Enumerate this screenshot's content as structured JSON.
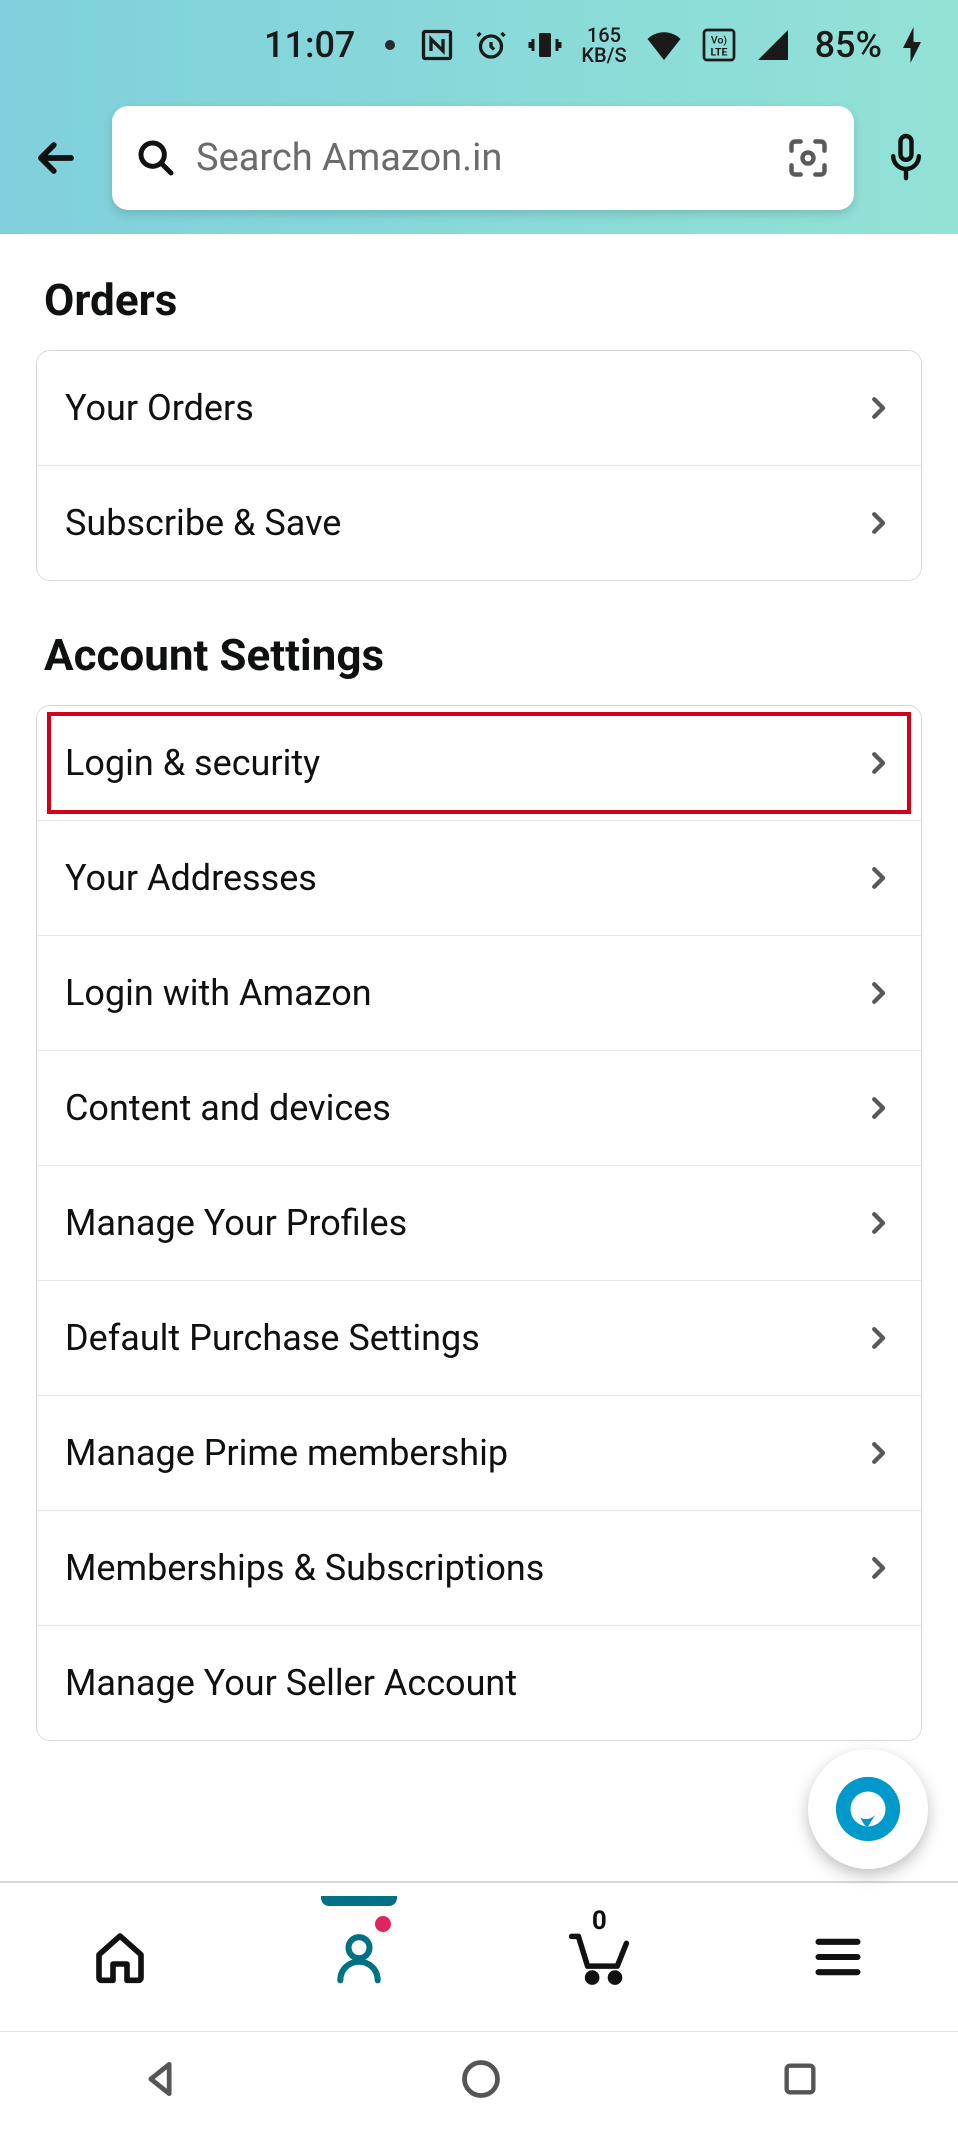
{
  "statusbar": {
    "time": "11:07",
    "network_speed_top": "165",
    "network_speed_bottom": "KB/S",
    "volte_label": "Vo)\nLTE",
    "battery_pct": "85%"
  },
  "header": {
    "search_placeholder": "Search Amazon.in"
  },
  "sections": {
    "orders": {
      "title": "Orders",
      "items": [
        {
          "label": "Your Orders"
        },
        {
          "label": "Subscribe & Save"
        }
      ]
    },
    "account": {
      "title": "Account Settings",
      "items": [
        {
          "label": "Login & security",
          "highlight": true
        },
        {
          "label": "Your Addresses"
        },
        {
          "label": "Login with Amazon"
        },
        {
          "label": "Content and devices"
        },
        {
          "label": "Manage Your Profiles"
        },
        {
          "label": "Default Purchase Settings"
        },
        {
          "label": "Manage Prime membership"
        },
        {
          "label": "Memberships & Subscriptions"
        },
        {
          "label": "Manage Your Seller Account"
        }
      ]
    }
  },
  "bottomnav": {
    "cart_count": "0"
  }
}
